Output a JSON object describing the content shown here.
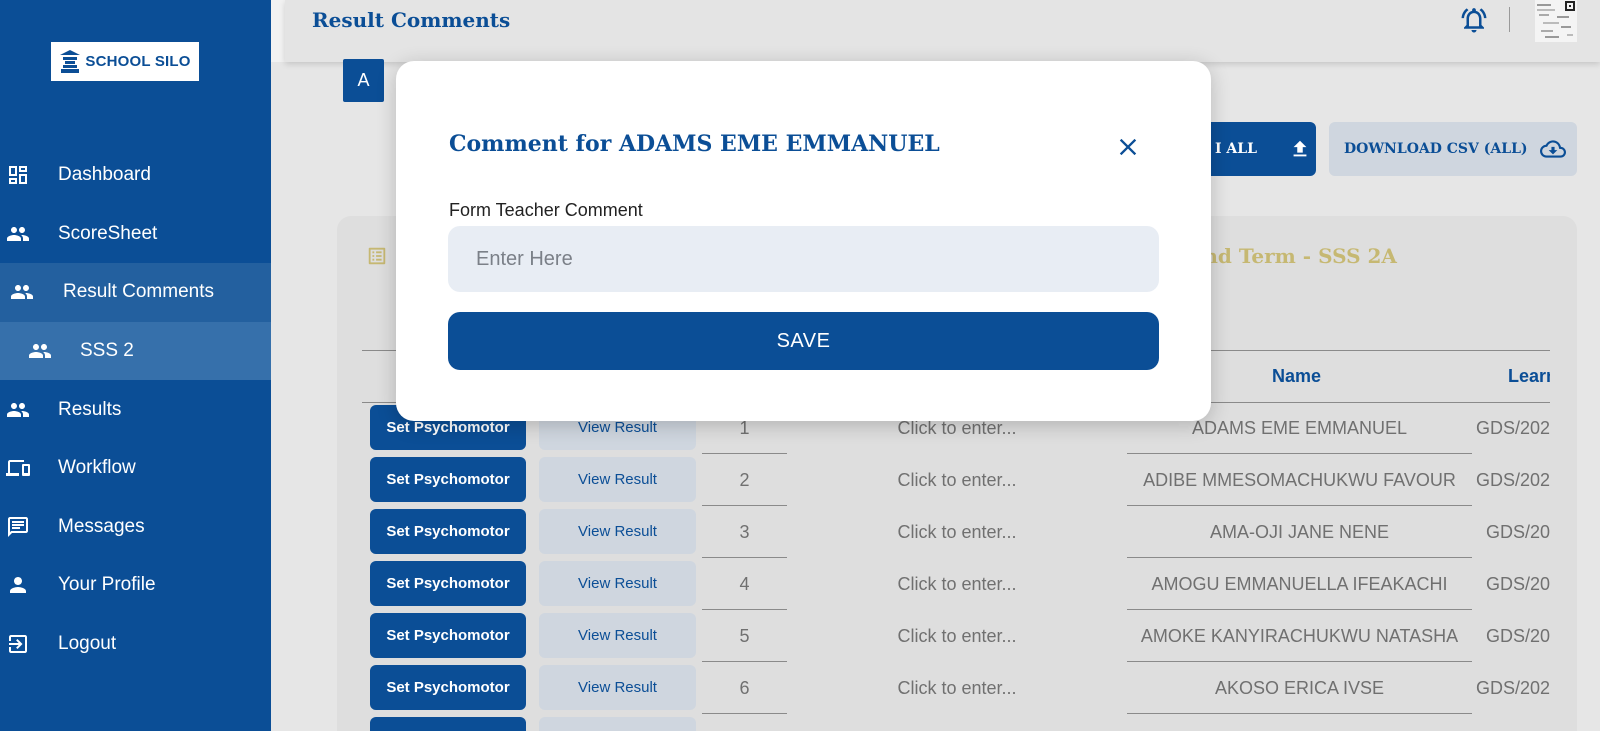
{
  "brand": {
    "logo_text": "SCHOOL SILO"
  },
  "header": {
    "title": "Result Comments"
  },
  "sidebar": {
    "items": [
      {
        "label": "Dashboard",
        "icon": "dashboard-icon"
      },
      {
        "label": "ScoreSheet",
        "icon": "people-icon"
      },
      {
        "label": "Result Comments",
        "icon": "people-icon"
      },
      {
        "label": "SSS 2",
        "icon": "people-icon"
      },
      {
        "label": "Results",
        "icon": "people-icon"
      },
      {
        "label": "Workflow",
        "icon": "devices-icon"
      },
      {
        "label": "Messages",
        "icon": "message-icon"
      },
      {
        "label": "Your Profile",
        "icon": "person-icon"
      },
      {
        "label": "Logout",
        "icon": "logout-icon"
      }
    ]
  },
  "main": {
    "tab_label": "A",
    "upload_all_label": "I ALL",
    "download_csv_label": "DOWNLOAD CSV (ALL)",
    "card_title": "ond Term - SSS 2A",
    "columns": {
      "name": "Name",
      "learner": "Learn"
    },
    "rows": [
      {
        "psy_label": "Set Psychomotor",
        "view_label": "View Result",
        "sn": "1",
        "comment": "Click to enter...",
        "name": "ADAMS EME EMMANUEL",
        "learner": "GDS/202"
      },
      {
        "psy_label": "Set Psychomotor",
        "view_label": "View Result",
        "sn": "2",
        "comment": "Click to enter...",
        "name": "ADIBE MMESOMACHUKWU FAVOUR",
        "learner": "GDS/202"
      },
      {
        "psy_label": "Set Psychomotor",
        "view_label": "View Result",
        "sn": "3",
        "comment": "Click to enter...",
        "name": "AMA-OJI JANE NENE",
        "learner": "GDS/20"
      },
      {
        "psy_label": "Set Psychomotor",
        "view_label": "View Result",
        "sn": "4",
        "comment": "Click to enter...",
        "name": "AMOGU EMMANUELLA IFEAKACHI",
        "learner": "GDS/20"
      },
      {
        "psy_label": "Set Psychomotor",
        "view_label": "View Result",
        "sn": "5",
        "comment": "Click to enter...",
        "name": "AMOKE KANYIRACHUKWU NATASHA",
        "learner": "GDS/20"
      },
      {
        "psy_label": "Set Psychomotor",
        "view_label": "View Result",
        "sn": "6",
        "comment": "Click to enter...",
        "name": "AKOSO ERICA IVSE",
        "learner": "GDS/202"
      }
    ]
  },
  "modal": {
    "title": "Comment for ADAMS EME EMMANUEL",
    "field_label": "Form Teacher Comment",
    "field_placeholder": "Enter Here",
    "field_value": "",
    "save_label": "SAVE"
  },
  "colors": {
    "primary": "#0b4e96",
    "accent_gold": "#c6b872",
    "muted_button": "#cfd6df"
  }
}
